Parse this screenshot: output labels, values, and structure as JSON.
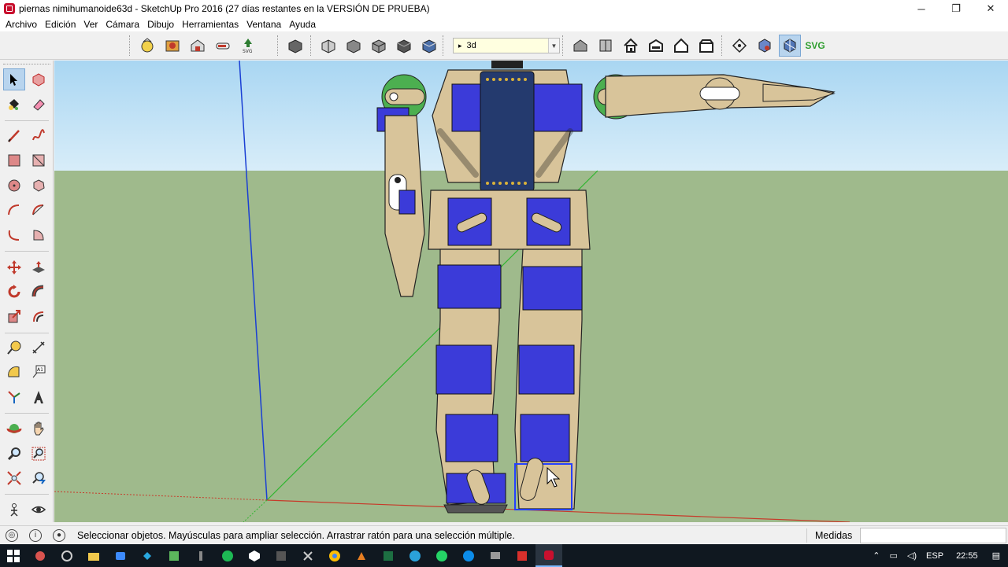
{
  "window": {
    "title": "piernas nimihumanoide63d - SketchUp Pro 2016 (27 días restantes en la VERSIÓN DE PRUEBA)",
    "controls": [
      "minimize",
      "restore",
      "close"
    ]
  },
  "menubar": {
    "items": [
      "Archivo",
      "Edición",
      "Ver",
      "Cámara",
      "Dibujo",
      "Herramientas",
      "Ventana",
      "Ayuda"
    ]
  },
  "toolbar": {
    "scene_select_value": "3d",
    "svg_label": "SVG",
    "icons_left": [
      "add-location-icon",
      "warehouse-icon",
      "share-model-icon",
      "extension-icon",
      "svg-export-icon"
    ],
    "icons_views": [
      "iso-view-icon",
      "top-view-icon",
      "front-view-icon",
      "right-view-icon",
      "back-view-icon",
      "left-view-icon"
    ],
    "icons_styles": [
      "xray-style-icon",
      "back-edges-icon",
      "home-view-icon",
      "section-plane-icon",
      "house-outline-icon",
      "house-solid-icon"
    ],
    "icons_right": [
      "orbit-icon",
      "component-icon",
      "3d-active-icon"
    ]
  },
  "colors": {
    "sky_top": "#a9d6f2",
    "ground": "#9fba8c",
    "servo_blue": "#3b3bd9",
    "frame_tan": "#d8c49a",
    "pcb_navy": "#243a6e",
    "horn_green": "#4caf50"
  },
  "statusbar": {
    "message": "Seleccionar objetos. Mayúsculas para ampliar selección. Arrastrar ratón para una selección múltiple.",
    "measure_label": "Medidas",
    "measure_value": ""
  },
  "taskbar": {
    "tray_lang": "ESP",
    "time": "22:55"
  }
}
